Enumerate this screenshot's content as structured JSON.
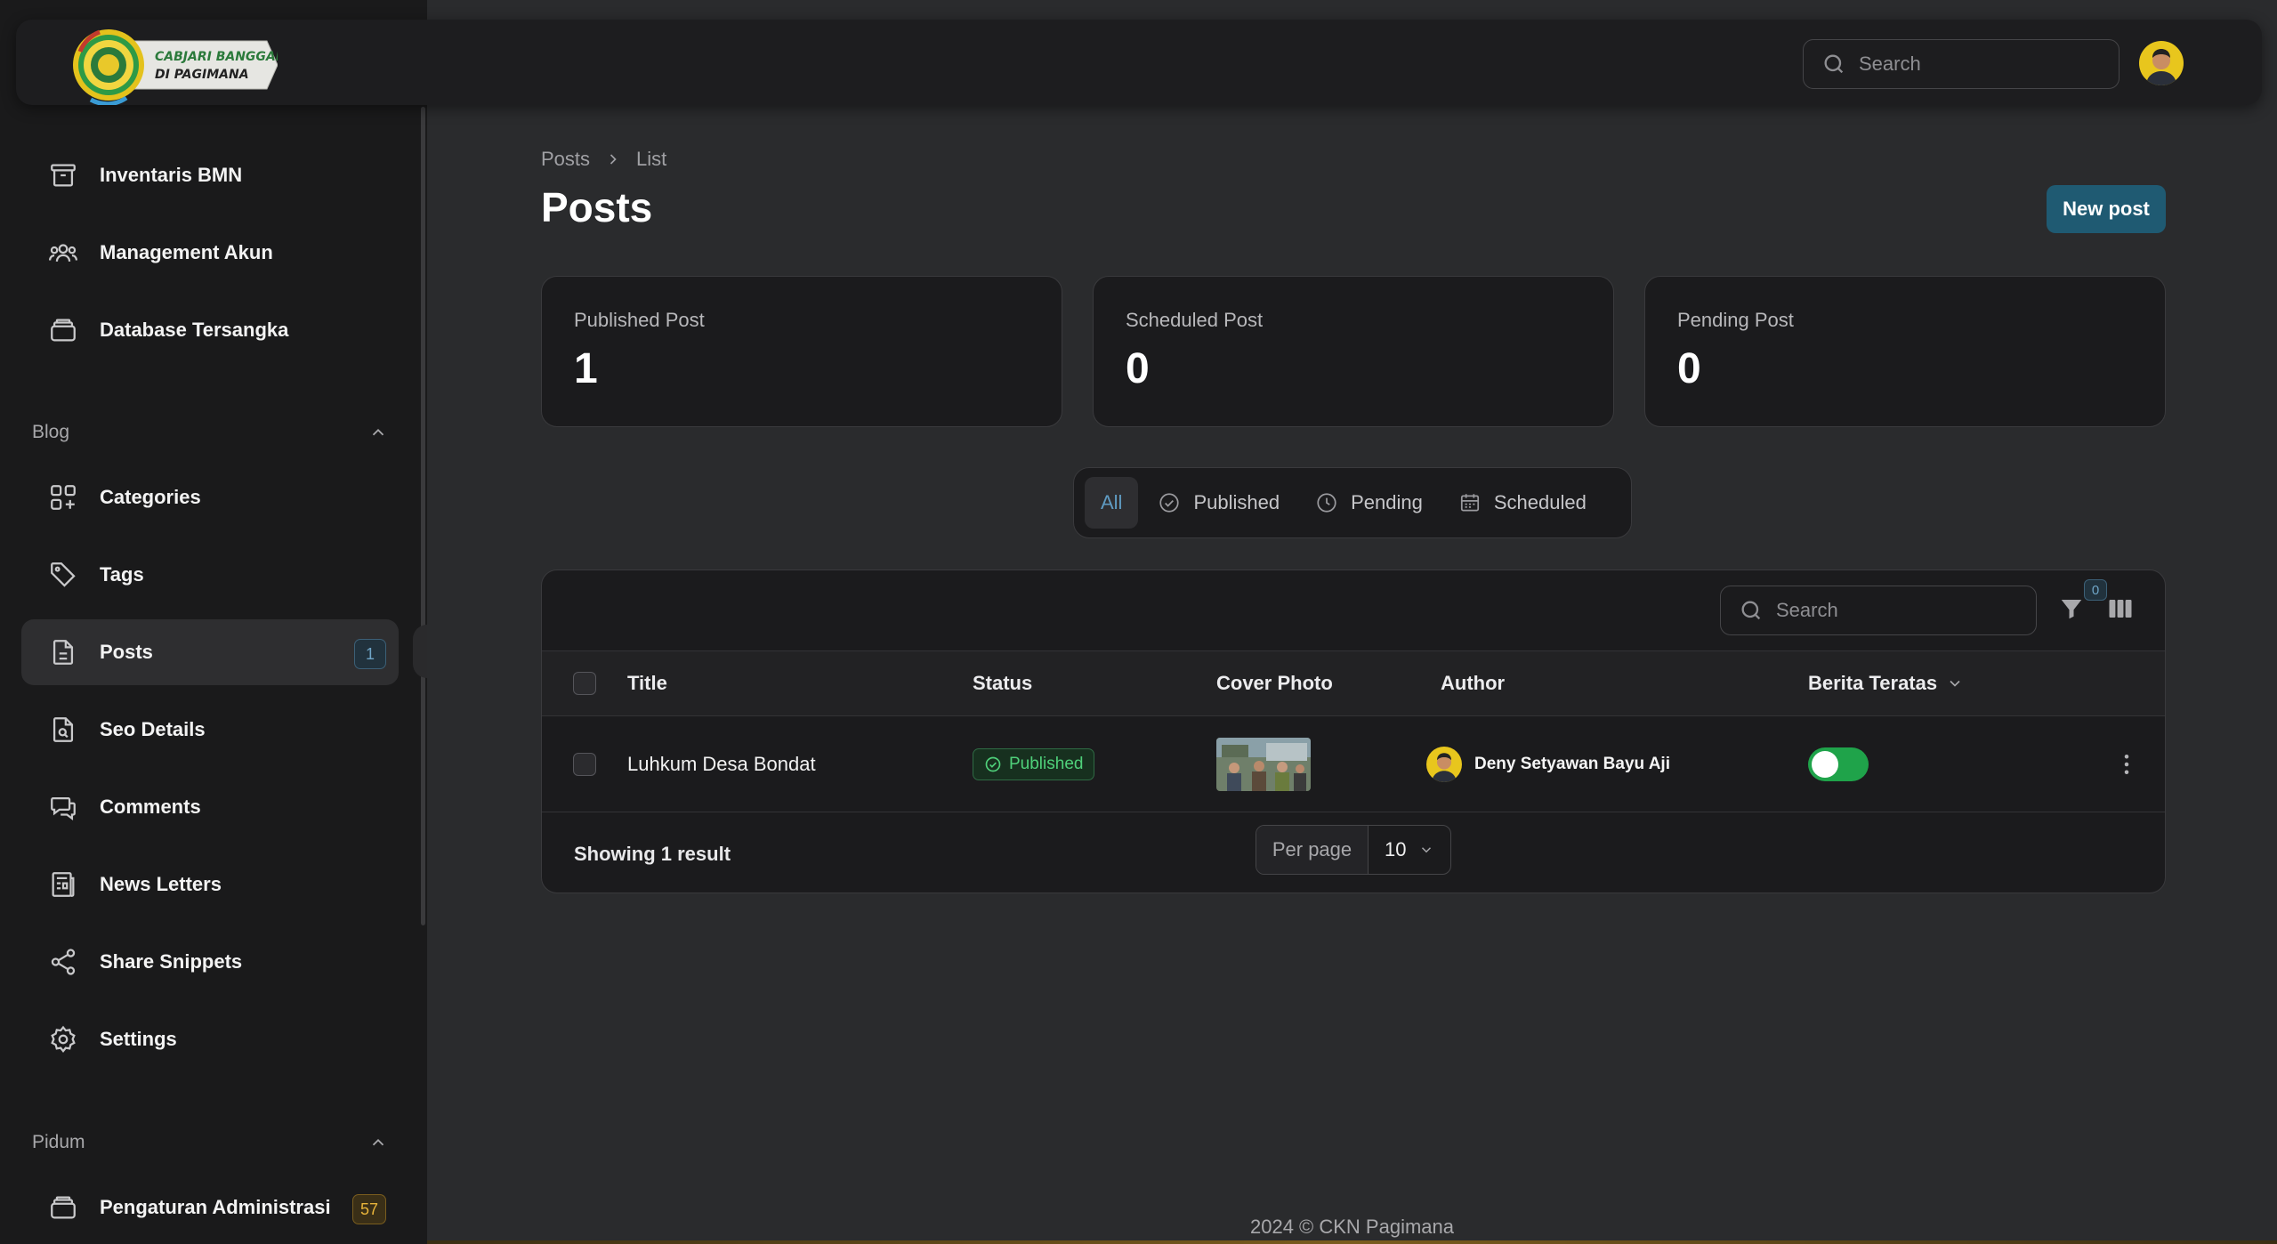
{
  "app": {
    "logo_text_line1": "CABJARI BANGGAI",
    "logo_text_line2": "DI PAGIMANA",
    "search_placeholder": "Search"
  },
  "sidebar": {
    "items_top": [
      {
        "label": "Inventaris BMN",
        "icon": "archive-icon"
      },
      {
        "label": "Management Akun",
        "icon": "users-icon"
      },
      {
        "label": "Database Tersangka",
        "icon": "stack-icon"
      }
    ],
    "blog_group": {
      "label": "Blog",
      "items": [
        {
          "label": "Categories",
          "icon": "grid-plus-icon"
        },
        {
          "label": "Tags",
          "icon": "tag-icon"
        },
        {
          "label": "Posts",
          "icon": "document-icon",
          "badge": "1",
          "active": true
        },
        {
          "label": "Seo Details",
          "icon": "document-search-icon"
        },
        {
          "label": "Comments",
          "icon": "chat-icon"
        },
        {
          "label": "News Letters",
          "icon": "newspaper-icon"
        },
        {
          "label": "Share Snippets",
          "icon": "share-icon"
        },
        {
          "label": "Settings",
          "icon": "gear-icon"
        }
      ]
    },
    "pidum_group": {
      "label": "Pidum",
      "items": [
        {
          "label": "Pengaturan Administrasi",
          "icon": "stack-icon",
          "badge": "57"
        }
      ]
    }
  },
  "main": {
    "breadcrumb": [
      "Posts",
      "List"
    ],
    "title": "Posts",
    "new_post_label": "New post",
    "stats": [
      {
        "label": "Published Post",
        "value": "1"
      },
      {
        "label": "Scheduled Post",
        "value": "0"
      },
      {
        "label": "Pending Post",
        "value": "0"
      }
    ],
    "tabs": [
      {
        "label": "All",
        "active": true
      },
      {
        "label": "Published",
        "icon": "check-circle-icon"
      },
      {
        "label": "Pending",
        "icon": "clock-icon"
      },
      {
        "label": "Scheduled",
        "icon": "calendar-icon"
      }
    ],
    "table": {
      "search_placeholder": "Search",
      "filter_count": "0",
      "columns": [
        "Title",
        "Status",
        "Cover Photo",
        "Author",
        "Berita Teratas"
      ],
      "rows": [
        {
          "title": "Luhkum Desa Bondat",
          "status": "Published",
          "author": "Deny Setyawan Bayu Aji",
          "berita_teratas": true
        }
      ],
      "summary": "Showing 1 result",
      "per_page_label": "Per page",
      "per_page_value": "10"
    }
  },
  "footer": {
    "text": "2024 © CKN Pagimana"
  },
  "colors": {
    "accent": "#1f5a72",
    "success": "#1fa34a",
    "badge_yellow": "#e8b43a"
  }
}
